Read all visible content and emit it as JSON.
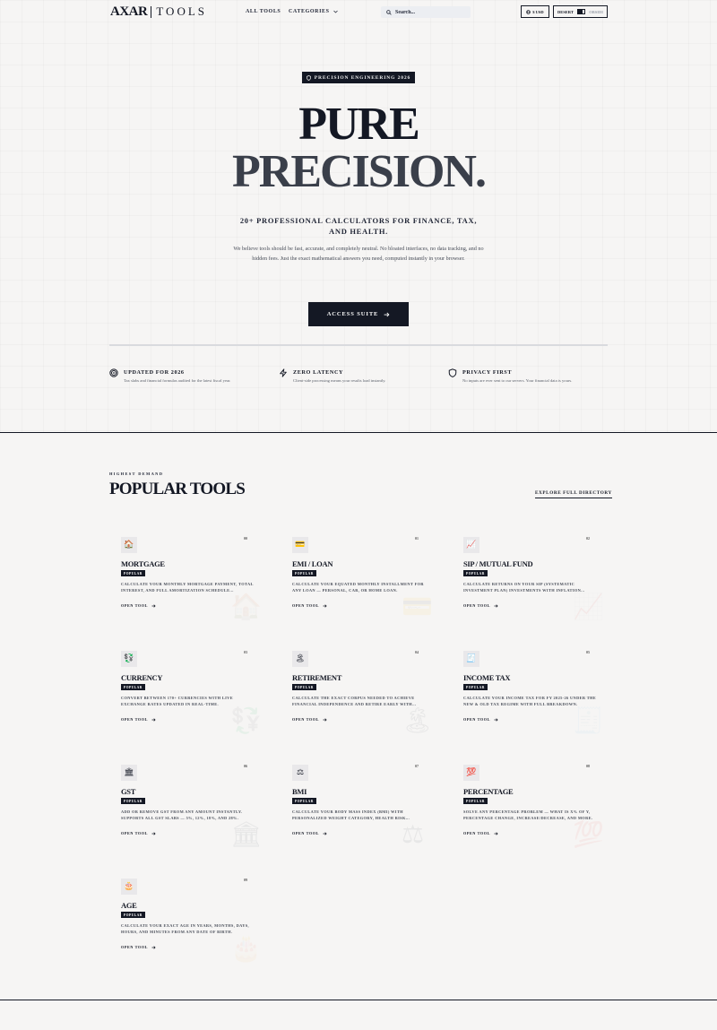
{
  "nav": {
    "logo_mark": "AXAR",
    "logo_text": "TOOLS",
    "all_tools": "ALL TOOLS",
    "categories": "CATEGORIES",
    "search_placeholder": "Search...",
    "currency": "$ USD",
    "mode_on": "DESERT",
    "mode_off": "OBSIDI"
  },
  "hero": {
    "badge": "PRECISION ENGINEERING 2026",
    "title_line1": "PURE",
    "title_line2": "PRECISION.",
    "subtitle": "20+ PROFESSIONAL CALCULATORS FOR FINANCE, TAX, AND HEALTH.",
    "description": "We believe tools should be fast, accurate, and completely neutral. No bloated interfaces, no data tracking, and no hidden fees. Just the exact mathematical answers you need, computed instantly in your browser.",
    "cta": "ACCESS SUITE"
  },
  "features": [
    {
      "icon": "target-icon",
      "title": "UPDATED FOR 2026",
      "desc": "Tax slabs and financial formulas audited for the latest fiscal year."
    },
    {
      "icon": "lightning-icon",
      "title": "ZERO LATENCY",
      "desc": "Client-side processing means your results load instantly."
    },
    {
      "icon": "shield-icon",
      "title": "PRIVACY FIRST",
      "desc": "No inputs are ever sent to our servers. Your financial data is yours."
    }
  ],
  "popular": {
    "eyebrow": "HIGHEST DEMAND",
    "title": "POPULAR TOOLS",
    "explore": "EXPLORE FULL DIRECTORY",
    "tag": "POPULAR",
    "open_label": "OPEN TOOL",
    "cards": [
      {
        "num": "00",
        "emoji": "🏠",
        "title": "MORTGAGE",
        "desc": "Calculate your monthly mortgage payment, total interest, and full amortization schedule..."
      },
      {
        "num": "01",
        "emoji": "💳",
        "title": "EMI / LOAN",
        "desc": "Calculate your equated monthly installment for any loan — personal, car, or home loan."
      },
      {
        "num": "02",
        "emoji": "📈",
        "title": "SIP / MUTUAL FUND",
        "desc": "Calculate returns on your SIP (systematic investment plan) investments with inflation..."
      },
      {
        "num": "03",
        "emoji": "💱",
        "title": "CURRENCY",
        "desc": "Convert between 170+ currencies with live exchange rates updated in real-time."
      },
      {
        "num": "04",
        "emoji": "🏝",
        "title": "RETIREMENT",
        "desc": "Calculate the exact corpus needed to achieve financial independence and retire early with..."
      },
      {
        "num": "05",
        "emoji": "🧾",
        "title": "INCOME TAX",
        "desc": "Calculate your income tax for FY 2025-26 under the new & old tax regime with full breakdown."
      },
      {
        "num": "06",
        "emoji": "🏛",
        "title": "GST",
        "desc": "Add or remove GST from any amount instantly. Supports all GST slabs — 5%, 12%, 18%, and 28%."
      },
      {
        "num": "07",
        "emoji": "⚖",
        "title": "BMI",
        "desc": "Calculate your body mass index (BMI) with personalized weight category, health risk..."
      },
      {
        "num": "08",
        "emoji": "💯",
        "title": "PERCENTAGE",
        "desc": "Solve any percentage problem — what is X% of Y, percentage change, increase/decrease, and more."
      },
      {
        "num": "09",
        "emoji": "🎂",
        "title": "AGE",
        "desc": "Calculate your exact age in years, months, days, hours, and minutes from any date of birth."
      }
    ]
  }
}
